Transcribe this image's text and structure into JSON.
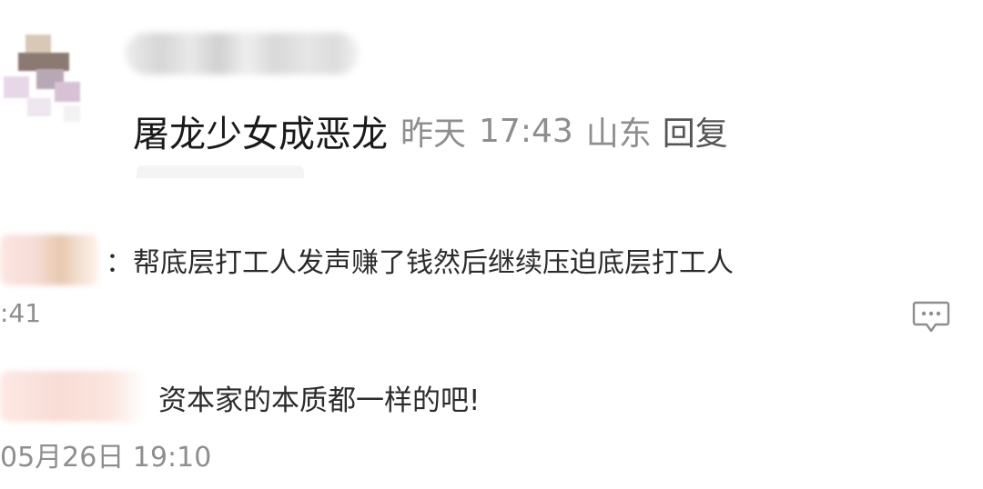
{
  "main_comment": {
    "text": "屠龙少女成恶龙",
    "date": "昨天",
    "time": "17:43",
    "location": "山东",
    "reply_label": "回复"
  },
  "replies": [
    {
      "separator": "：",
      "text": "帮底层打工人发声赚了钱然后继续压迫底层打工人",
      "time": ":41"
    },
    {
      "text": "资本家的本质都一样的吧!",
      "time": "05月26日 19:10"
    }
  ],
  "icons": {
    "comment": "comment-bubble-icon"
  },
  "colors": {
    "primary_text": "#1a1a1a",
    "meta_text": "#8e8e8e",
    "reply_label": "#555555"
  }
}
